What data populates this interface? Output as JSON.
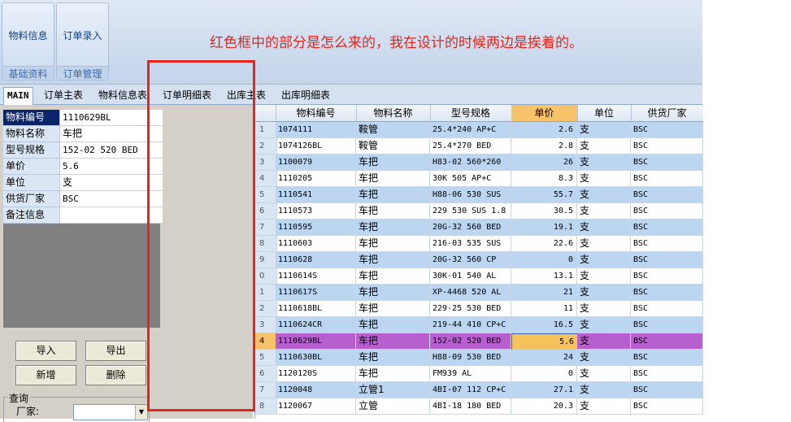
{
  "ribbon": {
    "groups": [
      {
        "button": "物料信息",
        "caption": "基础资料"
      },
      {
        "button": "订单录入",
        "caption": "订单管理"
      }
    ]
  },
  "annotation": "红色框中的部分是怎么来的，我在设计的时候两边是挨着的。",
  "tabs": [
    "MAIN",
    "订单主表",
    "物料信息表",
    "订单明细表",
    "出库主表",
    "出库明细表"
  ],
  "form": {
    "fields": [
      {
        "label": "物料编号",
        "value": "1110629BL"
      },
      {
        "label": "物料名称",
        "value": "车把"
      },
      {
        "label": "型号规格",
        "value": "152-02 520 BED"
      },
      {
        "label": "单价",
        "value": "5.6"
      },
      {
        "label": "单位",
        "value": "支"
      },
      {
        "label": "供货厂家",
        "value": "BSC"
      },
      {
        "label": "备注信息",
        "value": ""
      }
    ]
  },
  "buttons": {
    "import": "导入",
    "export": "导出",
    "add": "新增",
    "delete": "删除"
  },
  "query": {
    "legend": "查询",
    "label": "厂家:",
    "value": ""
  },
  "grid": {
    "columns": [
      "物料编号",
      "物料名称",
      "型号规格",
      "单价",
      "单位",
      "供货厂家"
    ],
    "rows": [
      {
        "rn": "1",
        "code": "1074111",
        "name": "鞍管",
        "spec": "25.4*240 AP+C",
        "price": "2.6",
        "unit": "支",
        "vendor": "BSC"
      },
      {
        "rn": "2",
        "code": "1074126BL",
        "name": "鞍管",
        "spec": "25.4*270 BED",
        "price": "2.8",
        "unit": "支",
        "vendor": "BSC"
      },
      {
        "rn": "3",
        "code": "1100079",
        "name": "车把",
        "spec": "H83-02 560*260",
        "price": "26",
        "unit": "支",
        "vendor": "BSC"
      },
      {
        "rn": "4",
        "code": "1110205",
        "name": "车把",
        "spec": "30K 505 AP+C",
        "price": "8.3",
        "unit": "支",
        "vendor": "BSC"
      },
      {
        "rn": "5",
        "code": "1110541",
        "name": "车把",
        "spec": "H88-06 530 SUS",
        "price": "55.7",
        "unit": "支",
        "vendor": "BSC"
      },
      {
        "rn": "6",
        "code": "1110573",
        "name": "车把",
        "spec": "229 530 SUS 1.8",
        "price": "30.5",
        "unit": "支",
        "vendor": "BSC"
      },
      {
        "rn": "7",
        "code": "1110595",
        "name": "车把",
        "spec": "20G-32 560 BED",
        "price": "19.1",
        "unit": "支",
        "vendor": "BSC"
      },
      {
        "rn": "8",
        "code": "1110603",
        "name": "车把",
        "spec": "216-03 535 SUS",
        "price": "22.6",
        "unit": "支",
        "vendor": "BSC"
      },
      {
        "rn": "9",
        "code": "1110628",
        "name": "车把",
        "spec": "20G-32 560 CP",
        "price": "0",
        "unit": "支",
        "vendor": "BSC"
      },
      {
        "rn": "0",
        "code": "1110614S",
        "name": "车把",
        "spec": "30K-01 540 AL",
        "price": "13.1",
        "unit": "支",
        "vendor": "BSC"
      },
      {
        "rn": "1",
        "code": "1110617S",
        "name": "车把",
        "spec": "XP-4468 520 AL",
        "price": "21",
        "unit": "支",
        "vendor": "BSC"
      },
      {
        "rn": "2",
        "code": "1110618BL",
        "name": "车把",
        "spec": "229-25 530 BED",
        "price": "11",
        "unit": "支",
        "vendor": "BSC"
      },
      {
        "rn": "3",
        "code": "1110624CR",
        "name": "车把",
        "spec": "219-44 410 CP+C",
        "price": "16.5",
        "unit": "支",
        "vendor": "BSC"
      },
      {
        "rn": "4",
        "code": "1110629BL",
        "name": "车把",
        "spec": "152-02 520 BED",
        "price": "5.6",
        "unit": "支",
        "vendor": "BSC"
      },
      {
        "rn": "5",
        "code": "1110630BL",
        "name": "车把",
        "spec": "H88-09 530 BED",
        "price": "24",
        "unit": "支",
        "vendor": "BSC"
      },
      {
        "rn": "6",
        "code": "1120120S",
        "name": "车把",
        "spec": "FM939 AL",
        "price": "0",
        "unit": "支",
        "vendor": "BSC"
      },
      {
        "rn": "7",
        "code": "1120048",
        "name": "立管1",
        "spec": "4BI-07 112 CP+C",
        "price": "27.1",
        "unit": "支",
        "vendor": "BSC"
      },
      {
        "rn": "8",
        "code": "1120067",
        "name": "立管",
        "spec": "4BI-18 180 BED",
        "price": "20.3",
        "unit": "支",
        "vendor": "BSC"
      }
    ]
  },
  "colors": {
    "annotation": "#e0271f",
    "selected_row": "#b75fcf",
    "highlight": "#f6c36b"
  }
}
